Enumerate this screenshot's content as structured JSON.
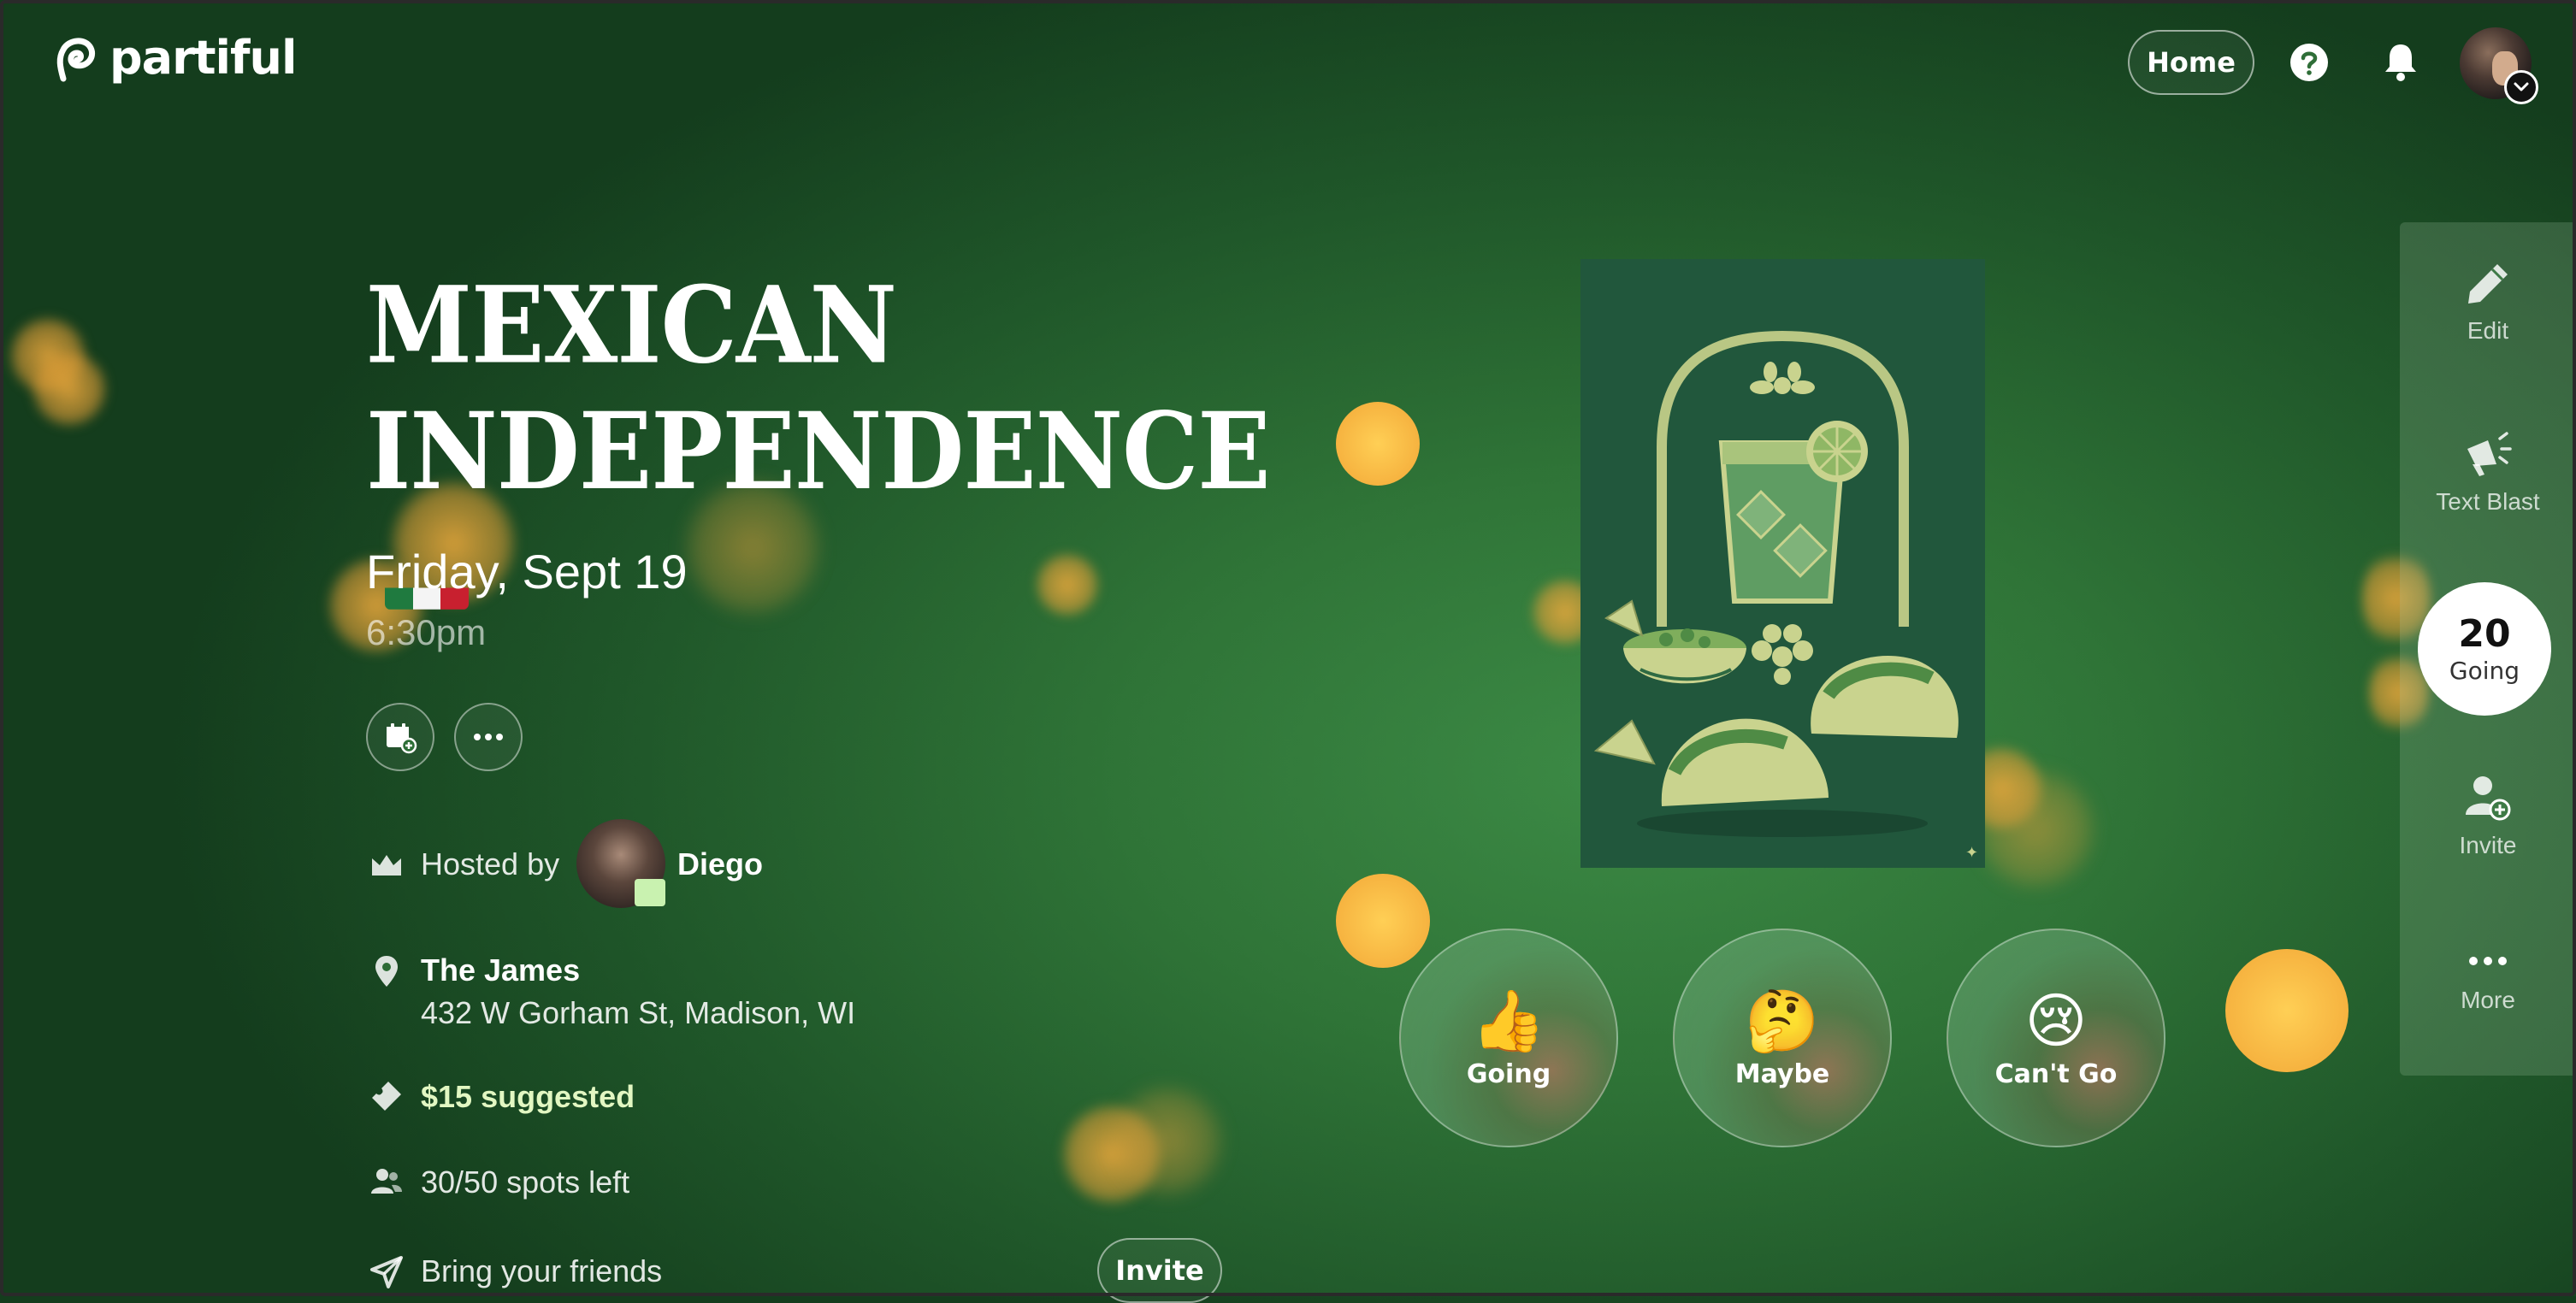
{
  "brand": {
    "name": "partiful"
  },
  "nav": {
    "home_label": "Home",
    "help_icon": "question-circle-icon",
    "notifications_icon": "bell-icon",
    "avatar_alt": "user-avatar"
  },
  "event": {
    "title_line1": "MEXICAN",
    "title_line2": "INDEPENDENCE",
    "flag": "mexico-flag",
    "date": "Friday, Sept 19",
    "time": "6:30pm",
    "actions": [
      "add-to-calendar",
      "more-options"
    ],
    "host": {
      "prefix": "Hosted by",
      "name": "Diego"
    },
    "location": {
      "name": "The James",
      "address": "432 W Gorham St, Madison, WI"
    },
    "price": "$15 suggested",
    "spots": "30/50 spots left",
    "bring_friends": "Bring your friends",
    "invite_label": "Invite"
  },
  "rsvp": [
    {
      "emoji": "👍",
      "label": "Going"
    },
    {
      "emoji": "🤔",
      "label": "Maybe"
    },
    {
      "emoji": "😢",
      "label": "Can't Go"
    }
  ],
  "sidebar": {
    "edit": "Edit",
    "text_blast": "Text Blast",
    "going_count": "20",
    "going_label": "Going",
    "invite": "Invite",
    "more": "More"
  },
  "colors": {
    "background": "#2f7437",
    "bokeh": "#f6b340",
    "price": "#e2f7c2",
    "poster": "#21573c"
  }
}
